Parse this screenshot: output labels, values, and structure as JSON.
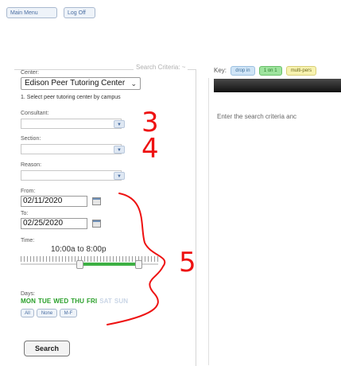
{
  "top_nav": {
    "main_menu_label": "Main Menu",
    "log_off_label": "Log Off"
  },
  "search_panel": {
    "legend": "Search Criteria: ~",
    "center": {
      "label": "Center:",
      "value": "Edison Peer Tutoring Center",
      "help": "1. Select peer tutoring center by campus"
    },
    "consultant": {
      "label": "Consultant:",
      "value": ""
    },
    "section": {
      "label": "Section:",
      "value": ""
    },
    "reason": {
      "label": "Reason:",
      "value": ""
    },
    "from": {
      "label": "From:",
      "value": "02/11/2020"
    },
    "to": {
      "label": "To:",
      "value": "02/25/2020"
    },
    "time": {
      "label": "Time:",
      "range": "10:00a to 8:00p"
    },
    "days": {
      "label": "Days:",
      "items": [
        {
          "name": "MON",
          "active": true
        },
        {
          "name": "TUE",
          "active": true
        },
        {
          "name": "WED",
          "active": true
        },
        {
          "name": "THU",
          "active": true
        },
        {
          "name": "FRI",
          "active": true
        },
        {
          "name": "SAT",
          "active": false
        },
        {
          "name": "SUN",
          "active": false
        }
      ],
      "buttons": [
        "All",
        "None",
        "M-F"
      ]
    },
    "search_label": "Search"
  },
  "results": {
    "key_label": "Key:",
    "key_items": [
      {
        "label": "drop in",
        "color": "#cfe4f6"
      },
      {
        "label": "1 on 1",
        "color": "#9ee39e"
      },
      {
        "label": "multi-pers",
        "color": "#f7f2b0"
      }
    ],
    "message": "Enter the search criteria anc"
  },
  "annotations": {
    "color": "#e11111",
    "numbers": [
      "3",
      "4",
      "5"
    ]
  }
}
